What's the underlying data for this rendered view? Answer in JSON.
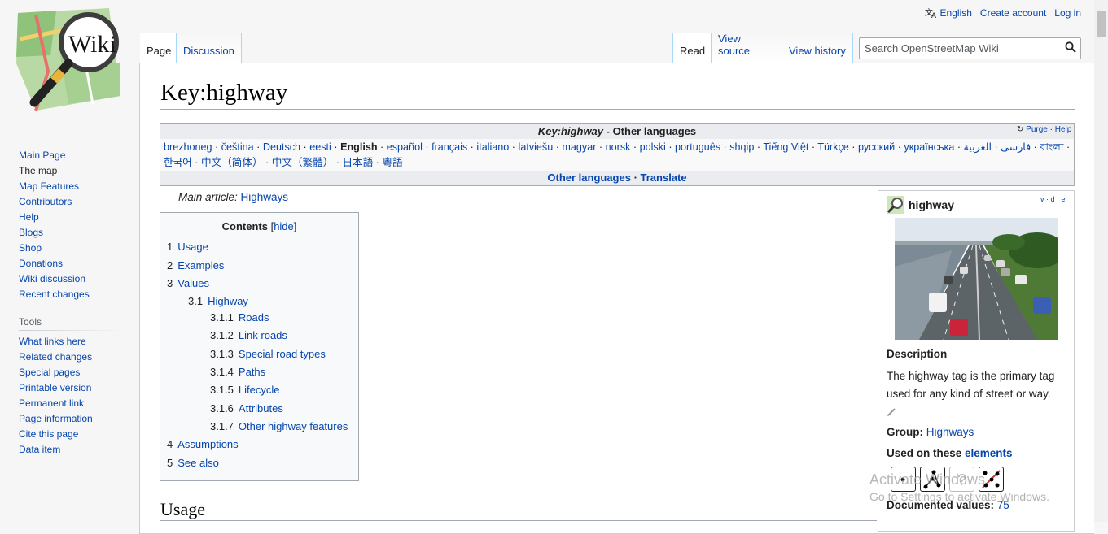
{
  "header": {
    "language_label": "English",
    "create_account": "Create account",
    "log_in": "Log in"
  },
  "tabs": {
    "left": [
      {
        "label": "Page"
      },
      {
        "label": "Discussion"
      }
    ],
    "right": [
      {
        "label": "Read"
      },
      {
        "label": "View source"
      },
      {
        "label": "View history"
      }
    ]
  },
  "search": {
    "placeholder": "Search OpenStreetMap Wiki"
  },
  "logo": {
    "text": "Wiki"
  },
  "sidebar": {
    "nav": [
      "Main Page",
      "The map",
      "Map Features",
      "Contributors",
      "Help",
      "Blogs",
      "Shop",
      "Donations",
      "Wiki discussion",
      "Recent changes"
    ],
    "tools_heading": "Tools",
    "tools": [
      "What links here",
      "Related changes",
      "Special pages",
      "Printable version",
      "Permanent link",
      "Page information",
      "Cite this page",
      "Data item"
    ]
  },
  "page": {
    "title": "Key:highway",
    "main_article_prefix": "Main article: ",
    "main_article_link": "Highways",
    "usage_heading": "Usage"
  },
  "languages": {
    "title_italic": "Key:highway",
    "title_rest": " - Other languages",
    "purge": "Purge",
    "help": "Help",
    "line1": [
      "brezhoneg",
      "čeština",
      "Deutsch",
      "eesti",
      "English",
      "español",
      "français",
      "italiano",
      "latviešu",
      "magyar",
      "norsk",
      "polski",
      "português",
      "shqip",
      "Tiếng Việt",
      "Türkçe",
      "русский",
      "українська",
      "فارسی",
      "العربية",
      "বাংলা"
    ],
    "line2": [
      "한국어",
      "中文（简体）",
      "中文（繁體）",
      "日本語",
      "粵語"
    ],
    "other_languages": "Other languages",
    "translate": "Translate"
  },
  "toc": {
    "title": "Contents",
    "hide": "hide",
    "items": [
      {
        "num": "1",
        "label": "Usage"
      },
      {
        "num": "2",
        "label": "Examples"
      },
      {
        "num": "3",
        "label": "Values"
      },
      {
        "num": "3.1",
        "label": "Highway"
      },
      {
        "num": "3.1.1",
        "label": "Roads"
      },
      {
        "num": "3.1.2",
        "label": "Link roads"
      },
      {
        "num": "3.1.3",
        "label": "Special road types"
      },
      {
        "num": "3.1.4",
        "label": "Paths"
      },
      {
        "num": "3.1.5",
        "label": "Lifecycle"
      },
      {
        "num": "3.1.6",
        "label": "Attributes"
      },
      {
        "num": "3.1.7",
        "label": "Other highway features"
      },
      {
        "num": "4",
        "label": "Assumptions"
      },
      {
        "num": "5",
        "label": "See also"
      }
    ]
  },
  "infobox": {
    "title": "highway",
    "vde": "v · d · e",
    "description_heading": "Description",
    "description": "The highway tag is the primary tag used for any kind of street or way.",
    "group_label": "Group: ",
    "group_value": "Highways",
    "used_on_prefix": "Used on these ",
    "used_on_link": "elements",
    "documented_label": "Documented values: ",
    "documented_value": "75"
  },
  "watermark": {
    "line1": "Activate Windows",
    "line2": "Go to Settings to activate Windows."
  },
  "colors": {
    "link": "#0645ad",
    "tab_border": "#a7d7f9",
    "text": "#202122"
  }
}
